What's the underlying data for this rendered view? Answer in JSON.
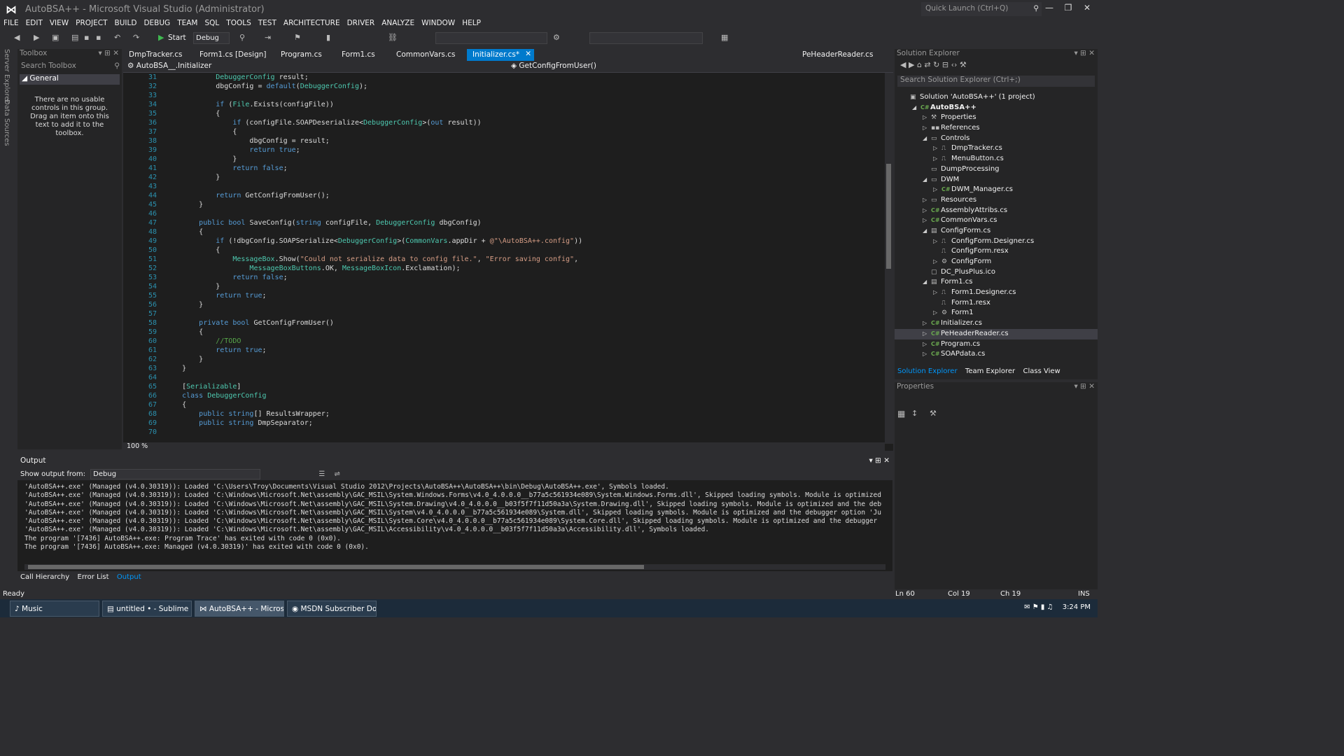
{
  "window": {
    "title": "AutoBSA++ - Microsoft Visual Studio (Administrator)",
    "quick_launch_placeholder": "Quick Launch (Ctrl+Q)"
  },
  "menu": [
    "FILE",
    "EDIT",
    "VIEW",
    "PROJECT",
    "BUILD",
    "DEBUG",
    "TEAM",
    "SQL",
    "TOOLS",
    "TEST",
    "ARCHITECTURE",
    "DRIVER",
    "ANALYZE",
    "WINDOW",
    "HELP"
  ],
  "toolbar": {
    "start_label": "Start",
    "config": "Debug"
  },
  "left_tabs": [
    "Server Explorer",
    "Data Sources"
  ],
  "toolbox": {
    "title": "Toolbox",
    "search_placeholder": "Search Toolbox",
    "group": "General",
    "message": "There are no usable controls in this group. Drag an item onto this text to add it to the toolbox."
  },
  "doc_tabs": [
    {
      "label": "DmpTracker.cs"
    },
    {
      "label": "Form1.cs [Design]"
    },
    {
      "label": "Program.cs"
    },
    {
      "label": "Form1.cs"
    },
    {
      "label": "CommonVars.cs"
    },
    {
      "label": "Initializer.cs*",
      "active": true
    },
    {
      "label": "PeHeaderReader.cs"
    }
  ],
  "nav": {
    "class": "AutoBSA__.Initializer",
    "member": "GetConfigFromUser()"
  },
  "code": {
    "line_numbers": [
      31,
      32,
      33,
      34,
      35,
      36,
      37,
      38,
      39,
      40,
      41,
      42,
      43,
      44,
      45,
      46,
      47,
      48,
      49,
      50,
      51,
      52,
      53,
      54,
      55,
      56,
      57,
      58,
      59,
      60,
      61,
      62,
      63,
      64,
      65,
      66,
      67,
      68,
      69,
      70
    ],
    "lines": [
      "            DebuggerConfig result;",
      "            dbgConfig = default(DebuggerConfig);",
      "",
      "            if (File.Exists(configFile))",
      "            {",
      "                if (configFile.SOAPDeserialize<DebuggerConfig>(out result))",
      "                {",
      "                    dbgConfig = result;",
      "                    return true;",
      "                }",
      "                return false;",
      "            }",
      "",
      "            return GetConfigFromUser();",
      "        }",
      "",
      "        public bool SaveConfig(string configFile, DebuggerConfig dbgConfig)",
      "        {",
      "            if (!dbgConfig.SOAPSerialize<DebuggerConfig>(CommonVars.appDir + @\"\\AutoBSA++.config\"))",
      "            {",
      "                MessageBox.Show(\"Could not serialize data to config file.\", \"Error saving config\",",
      "                    MessageBoxButtons.OK, MessageBoxIcon.Exclamation);",
      "                return false;",
      "            }",
      "            return true;",
      "        }",
      "",
      "        private bool GetConfigFromUser()",
      "        {",
      "            //TODO",
      "            return true;",
      "        }",
      "    }",
      "",
      "    [Serializable]",
      "    class DebuggerConfig",
      "    {",
      "        public string[] ResultsWrapper;",
      "        public string DmpSeparator;",
      ""
    ]
  },
  "zoom": "100 %",
  "solution_explorer": {
    "title": "Solution Explorer",
    "search_placeholder": "Search Solution Explorer (Ctrl+;)",
    "tree": [
      {
        "label": "Solution 'AutoBSA++' (1 project)",
        "level": 0,
        "exp": "",
        "icon": "solution"
      },
      {
        "label": "AutoBSA++",
        "level": 1,
        "exp": "open",
        "icon": "cs-project",
        "bold": true
      },
      {
        "label": "Properties",
        "level": 2,
        "exp": "closed",
        "icon": "wrench"
      },
      {
        "label": "References",
        "level": 2,
        "exp": "closed",
        "icon": "references"
      },
      {
        "label": "Controls",
        "level": 2,
        "exp": "open",
        "icon": "folder"
      },
      {
        "label": "DmpTracker.cs",
        "level": 3,
        "exp": "closed",
        "icon": "component"
      },
      {
        "label": "MenuButton.cs",
        "level": 3,
        "exp": "closed",
        "icon": "component"
      },
      {
        "label": "DumpProcessing",
        "level": 2,
        "exp": "",
        "icon": "folder"
      },
      {
        "label": "DWM",
        "level": 2,
        "exp": "open",
        "icon": "folder"
      },
      {
        "label": "DWM_Manager.cs",
        "level": 3,
        "exp": "closed",
        "icon": "cs-file"
      },
      {
        "label": "Resources",
        "level": 2,
        "exp": "closed",
        "icon": "folder"
      },
      {
        "label": "AssemblyAttribs.cs",
        "level": 2,
        "exp": "closed",
        "icon": "cs-file"
      },
      {
        "label": "CommonVars.cs",
        "level": 2,
        "exp": "closed",
        "icon": "cs-file"
      },
      {
        "label": "ConfigForm.cs",
        "level": 2,
        "exp": "open",
        "icon": "form"
      },
      {
        "label": "ConfigForm.Designer.cs",
        "level": 3,
        "exp": "closed",
        "icon": "designer"
      },
      {
        "label": "ConfigForm.resx",
        "level": 3,
        "exp": "",
        "icon": "resx"
      },
      {
        "label": "ConfigForm",
        "level": 3,
        "exp": "closed",
        "icon": "class"
      },
      {
        "label": "DC_PlusPlus.ico",
        "level": 2,
        "exp": "",
        "icon": "icon-file"
      },
      {
        "label": "Form1.cs",
        "level": 2,
        "exp": "open",
        "icon": "form"
      },
      {
        "label": "Form1.Designer.cs",
        "level": 3,
        "exp": "closed",
        "icon": "designer"
      },
      {
        "label": "Form1.resx",
        "level": 3,
        "exp": "",
        "icon": "resx"
      },
      {
        "label": "Form1",
        "level": 3,
        "exp": "closed",
        "icon": "class"
      },
      {
        "label": "Initializer.cs",
        "level": 2,
        "exp": "closed",
        "icon": "cs-file"
      },
      {
        "label": "PeHeaderReader.cs",
        "level": 2,
        "exp": "closed",
        "icon": "cs-file",
        "selected": true
      },
      {
        "label": "Program.cs",
        "level": 2,
        "exp": "closed",
        "icon": "cs-file"
      },
      {
        "label": "SOAPdata.cs",
        "level": 2,
        "exp": "closed",
        "icon": "cs-file"
      }
    ],
    "tabs": [
      "Solution Explorer",
      "Team Explorer",
      "Class View"
    ]
  },
  "properties": {
    "title": "Properties"
  },
  "output": {
    "title": "Output",
    "show_from_label": "Show output from:",
    "source": "Debug",
    "lines": [
      "'AutoBSA++.exe' (Managed (v4.0.30319)): Loaded 'C:\\Users\\Troy\\Documents\\Visual Studio 2012\\Projects\\AutoBSA++\\AutoBSA++\\bin\\Debug\\AutoBSA++.exe', Symbols loaded.",
      "'AutoBSA++.exe' (Managed (v4.0.30319)): Loaded 'C:\\Windows\\Microsoft.Net\\assembly\\GAC_MSIL\\System.Windows.Forms\\v4.0_4.0.0.0__b77a5c561934e089\\System.Windows.Forms.dll', Skipped loading symbols. Module is optimized",
      "'AutoBSA++.exe' (Managed (v4.0.30319)): Loaded 'C:\\Windows\\Microsoft.Net\\assembly\\GAC_MSIL\\System.Drawing\\v4.0_4.0.0.0__b03f5f7f11d50a3a\\System.Drawing.dll', Skipped loading symbols. Module is optimized and the debu",
      "'AutoBSA++.exe' (Managed (v4.0.30319)): Loaded 'C:\\Windows\\Microsoft.Net\\assembly\\GAC_MSIL\\System\\v4.0_4.0.0.0__b77a5c561934e089\\System.dll', Skipped loading symbols. Module is optimized and the debugger option 'Ju",
      "'AutoBSA++.exe' (Managed (v4.0.30319)): Loaded 'C:\\Windows\\Microsoft.Net\\assembly\\GAC_MSIL\\System.Core\\v4.0_4.0.0.0__b77a5c561934e089\\System.Core.dll', Skipped loading symbols. Module is optimized and the debugger",
      "'AutoBSA++.exe' (Managed (v4.0.30319)): Loaded 'C:\\Windows\\Microsoft.Net\\assembly\\GAC_MSIL\\Accessibility\\v4.0_4.0.0.0__b03f5f7f11d50a3a\\Accessibility.dll', Symbols loaded.",
      "The program '[7436] AutoBSA++.exe: Program Trace' has exited with code 0 (0x0).",
      "The program '[7436] AutoBSA++.exe: Managed (v4.0.30319)' has exited with code 0 (0x0)."
    ]
  },
  "bottom_tabs": [
    "Call Hierarchy",
    "Error List",
    "Output"
  ],
  "status": {
    "text": "Ready",
    "ln": "Ln 60",
    "col": "Col 19",
    "ch": "Ch 19",
    "ins": "INS"
  },
  "taskbar": {
    "items": [
      "Music",
      "untitled • - Sublime ...",
      "AutoBSA++ - Micros...",
      "MSDN Subscriber Do..."
    ],
    "clock": "3:24 PM"
  }
}
